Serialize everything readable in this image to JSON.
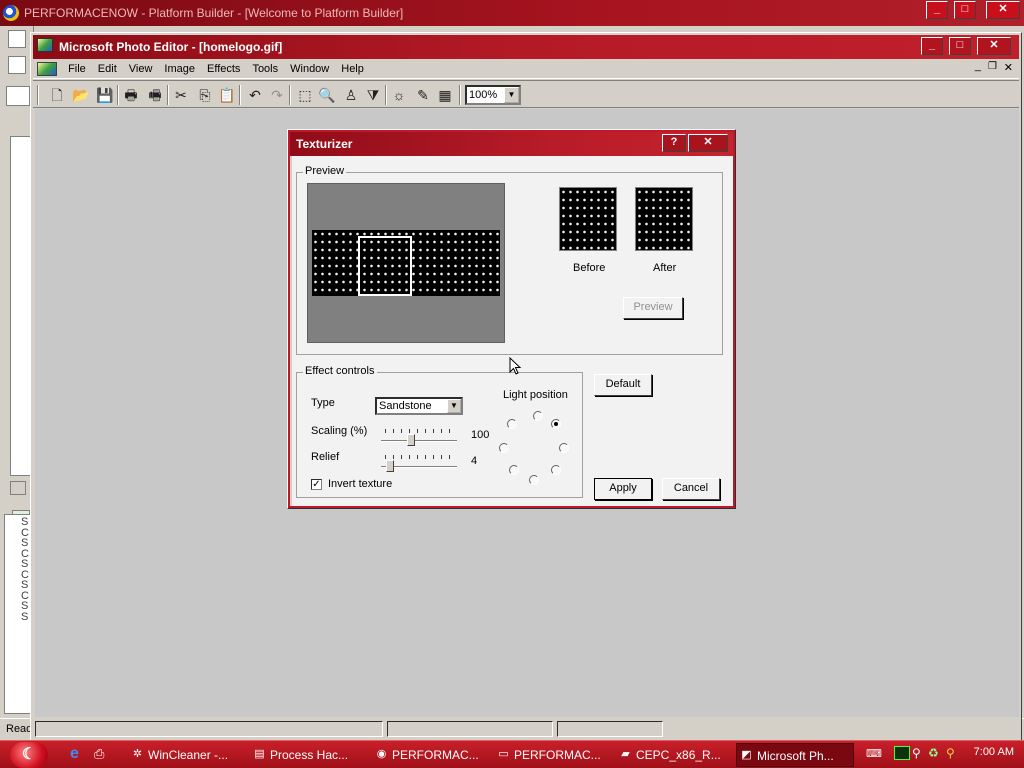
{
  "background_window": {
    "title": "PERFORMACENOW - Platform Builder - [Welcome to Platform Builder]",
    "status_text": "Read",
    "left_strip_letters": [
      "S",
      "C",
      "S",
      "C",
      "S",
      "C",
      "S",
      "C",
      "S",
      "S"
    ]
  },
  "photo_editor": {
    "title": "Microsoft Photo Editor - [homelogo.gif]",
    "menu": [
      "File",
      "Edit",
      "View",
      "Image",
      "Effects",
      "Tools",
      "Window",
      "Help"
    ],
    "zoom": "100%"
  },
  "dialog": {
    "title": "Texturizer",
    "help_glyph": "?",
    "close_glyph": "✕",
    "preview_group": "Preview",
    "before_label": "Before",
    "after_label": "After",
    "preview_button": "Preview",
    "effect_group": "Effect controls",
    "type_label": "Type",
    "type_value": "Sandstone",
    "scaling_label": "Scaling (%)",
    "scaling_value": "100",
    "scaling_fraction": 0.38,
    "relief_label": "Relief",
    "relief_value": "4",
    "relief_fraction": 0.08,
    "invert_label": "Invert texture",
    "invert_checked": true,
    "light_position_label": "Light position",
    "light_position_selected": "top-right",
    "default_button": "Default",
    "apply_button": "Apply",
    "cancel_button": "Cancel"
  },
  "taskbar": {
    "items": [
      {
        "label": "WinCleaner -...",
        "icon": "wincleaner-icon",
        "active": false
      },
      {
        "label": "Process Hac...",
        "icon": "process-hacker-icon",
        "active": false
      },
      {
        "label": "PERFORMAC...",
        "icon": "platform-builder-icon",
        "active": false
      },
      {
        "label": "PERFORMAC...",
        "icon": "console-icon",
        "active": false
      },
      {
        "label": "CEPC_x86_R...",
        "icon": "folder-icon",
        "active": false
      },
      {
        "label": "Microsoft Ph...",
        "icon": "photo-editor-icon",
        "active": true
      }
    ],
    "clock": "7:00 AM"
  },
  "colors": {
    "titlebar": "#b41a26",
    "taskbar": "#c8202a",
    "dialog_body": "#f2f2f2",
    "workspace": "#c8c8c8"
  }
}
